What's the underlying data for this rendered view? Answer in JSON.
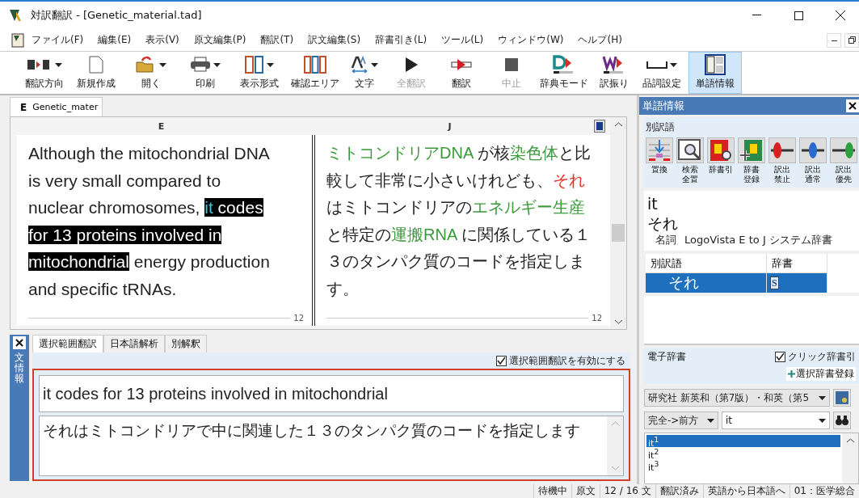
{
  "window": {
    "title": "対訳翻訳 - [Genetic_material.tad]"
  },
  "menu": [
    "ファイル(F)",
    "編集(E)",
    "表示(V)",
    "原文編集(P)",
    "翻訳(T)",
    "訳文編集(S)",
    "辞書引き(L)",
    "ツール(L)",
    "ウィンドウ(W)",
    "ヘルプ(H)"
  ],
  "toolbar": [
    {
      "label": "翻訳方向",
      "dropdown": true,
      "disabled": false,
      "selected": false
    },
    {
      "label": "新規作成",
      "dropdown": false,
      "disabled": false,
      "selected": false
    },
    {
      "label": "開く",
      "dropdown": true,
      "disabled": false,
      "selected": false
    },
    {
      "label": "印刷",
      "dropdown": true,
      "disabled": false,
      "selected": false
    },
    {
      "label": "表示形式",
      "dropdown": true,
      "disabled": false,
      "selected": false
    },
    {
      "label": "確認エリア",
      "dropdown": false,
      "disabled": false,
      "selected": false
    },
    {
      "label": "文字",
      "dropdown": true,
      "disabled": false,
      "selected": false
    },
    {
      "label": "全翻訳",
      "dropdown": false,
      "disabled": true,
      "selected": false
    },
    {
      "label": "翻訳",
      "dropdown": false,
      "disabled": false,
      "selected": false
    },
    {
      "label": "中止",
      "dropdown": false,
      "disabled": true,
      "selected": false
    },
    {
      "label": "辞典モード",
      "dropdown": false,
      "disabled": false,
      "selected": false
    },
    {
      "label": "訳振り",
      "dropdown": false,
      "disabled": false,
      "selected": false
    },
    {
      "label": "品詞設定",
      "dropdown": true,
      "disabled": false,
      "selected": false
    },
    {
      "label": "単語情報",
      "dropdown": false,
      "disabled": false,
      "selected": true
    }
  ],
  "document": {
    "tab": {
      "letter": "E",
      "label": "Genetic_mater"
    },
    "columns": [
      "E",
      "J"
    ],
    "source": [
      {
        "kind": "plain",
        "text": "Although the mitochondrial DNA is very small compared to nuclear chromosomes, "
      },
      {
        "kind": "selected_word",
        "text": "it"
      },
      {
        "kind": "selected",
        "text": " codes for 13 proteins involved in mitochondrial"
      },
      {
        "kind": "plain",
        "text": " energy production and specific tRNAs."
      }
    ],
    "target": [
      {
        "text": "ミトコンドリアDNA",
        "color": "#3a9a3a"
      },
      {
        "text": " が核",
        "color": "#222222"
      },
      {
        "text": "染色体",
        "color": "#3a9a3a"
      },
      {
        "text": "と比較して非常に小さいけれども、",
        "color": "#222222"
      },
      {
        "text": "それ",
        "color": "#e8302a"
      },
      {
        "text": "はミトコンドリアの",
        "color": "#222222"
      },
      {
        "text": "エネルギー生産",
        "color": "#3a9a3a"
      },
      {
        "text": "と特定の",
        "color": "#222222"
      },
      {
        "text": "運搬RNA",
        "color": "#3a9a3a"
      },
      {
        "text": " に関係している１３のタンパク質のコードを指定します。",
        "color": "#222222"
      }
    ],
    "page_numbers": [
      "12",
      "12"
    ]
  },
  "sentence_panel": {
    "title": "文情報",
    "tabs": [
      {
        "label": "選択範囲翻訳",
        "selected": true
      },
      {
        "label": "日本語解析",
        "selected": false
      },
      {
        "label": "別解釈",
        "selected": false
      }
    ],
    "enable": {
      "label": "選択範囲翻訳を有効にする",
      "checked": true
    },
    "source": "it codes for 13 proteins involved in mitochondrial",
    "target": "それはミトコンドリアで中に関連した１３のタンパク質のコードを指定します"
  },
  "word_panel": {
    "title": "単語情報",
    "section": "別訳語",
    "tools": [
      [
        "置換"
      ],
      [
        "検索",
        "全置"
      ],
      [
        "辞書引"
      ],
      [
        "辞書",
        "登録"
      ],
      [
        "訳出",
        "禁止"
      ],
      [
        "訳出",
        "通常"
      ],
      [
        "訳出",
        "優先"
      ]
    ],
    "word": "it",
    "translation": "それ",
    "pos": "名詞",
    "dictionary": "LogoVista E to J システム辞書",
    "table": {
      "columns": [
        "別訳語",
        "辞書"
      ],
      "rows": [
        {
          "word": "それ",
          "dict": "S",
          "selected": true
        }
      ]
    }
  },
  "e_dictionary": {
    "title": "電子辞書",
    "click_lookup": {
      "label": "クリック辞書引",
      "checked": true
    },
    "register": "選択辞書登録",
    "dictionary": "研究社 新英和（第7版）・和英（第5",
    "mode": "完全->前方",
    "query": "it",
    "results": [
      {
        "text": "it$^{1}$",
        "selected": true
      },
      {
        "text": "it$^{2}$",
        "selected": false
      },
      {
        "text": "it$^{3}$",
        "selected": false
      }
    ]
  },
  "status_bar": [
    "待機中",
    "原文",
    "12 / 16 文",
    "翻訳済み",
    "英語から日本語へ",
    "01：医学総合"
  ]
}
